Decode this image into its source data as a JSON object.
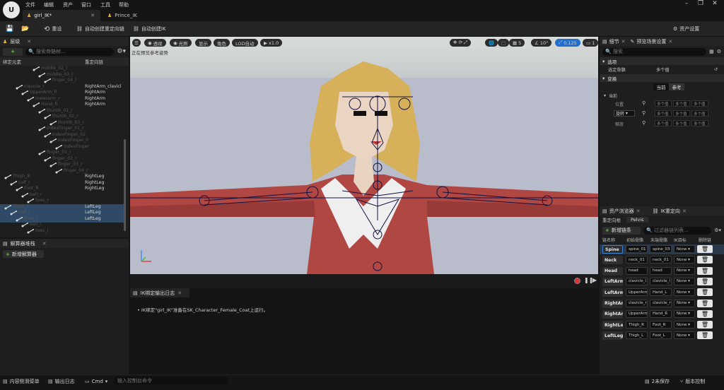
{
  "menu": [
    "文件",
    "编辑",
    "资产",
    "窗口",
    "工具",
    "帮助"
  ],
  "tabs": [
    {
      "label": "girl_IK*"
    },
    {
      "label": "Prince_IK"
    }
  ],
  "toolbar": {
    "reimport": "重设",
    "auto_chain": "自动创建重定向链",
    "auto_ik": "自动创建IK",
    "asset_settings": "资产设置"
  },
  "hierarchy": {
    "title": "层级",
    "add": "+",
    "search_placeholder": "搜索骨骼树...",
    "col_bone": "绑定元素",
    "col_retarget": "重定向链",
    "rows": [
      {
        "name": "middle_02_l",
        "chain": "",
        "indent": 58,
        "selected": false
      },
      {
        "name": "middle_03_l",
        "chain": "",
        "indent": 66,
        "selected": false
      },
      {
        "name": "finger_04_l",
        "chain": "",
        "indent": 74,
        "selected": false
      },
      {
        "name": "clavicle_r",
        "chain": "RightArm_clavicl",
        "indent": 34,
        "selected": false
      },
      {
        "name": "UpperArm_R",
        "chain": "RightArm",
        "indent": 42,
        "selected": false
      },
      {
        "name": "lowerarm_r",
        "chain": "RightArm",
        "indent": 50,
        "selected": false
      },
      {
        "name": "Hand_R",
        "chain": "RightArm",
        "indent": 58,
        "selected": false
      },
      {
        "name": "thumb_01_r",
        "chain": "",
        "indent": 66,
        "selected": false
      },
      {
        "name": "thumb_02_r",
        "chain": "",
        "indent": 74,
        "selected": false
      },
      {
        "name": "thumb_03_r",
        "chain": "",
        "indent": 82,
        "selected": false
      },
      {
        "name": "IndexFinger_01_r",
        "chain": "",
        "indent": 66,
        "selected": false
      },
      {
        "name": "IndexFinger_02",
        "chain": "",
        "indent": 74,
        "selected": false
      },
      {
        "name": "IndexFinger_0",
        "chain": "",
        "indent": 82,
        "selected": false
      },
      {
        "name": "IndexFinger",
        "chain": "",
        "indent": 90,
        "selected": false
      },
      {
        "name": "finger_01_r",
        "chain": "",
        "indent": 66,
        "selected": false
      },
      {
        "name": "finger_02_r",
        "chain": "",
        "indent": 74,
        "selected": false
      },
      {
        "name": "finger_03_r",
        "chain": "",
        "indent": 82,
        "selected": false
      },
      {
        "name": "finger_04_r",
        "chain": "",
        "indent": 90,
        "selected": false
      },
      {
        "name": "Thigh_R",
        "chain": "RightLeg",
        "indent": 18,
        "selected": false
      },
      {
        "name": "calf_r",
        "chain": "RightLeg",
        "indent": 26,
        "selected": false
      },
      {
        "name": "Foot_R",
        "chain": "RightLeg",
        "indent": 34,
        "selected": false
      },
      {
        "name": "ball_r",
        "chain": "",
        "indent": 42,
        "selected": false
      },
      {
        "name": "toes_r",
        "chain": "",
        "indent": 50,
        "selected": false
      },
      {
        "name": "Thigh_L",
        "chain": "LeftLeg",
        "indent": 18,
        "selected": true
      },
      {
        "name": "calf_l",
        "chain": "LeftLeg",
        "indent": 26,
        "selected": true
      },
      {
        "name": "Foot_L",
        "chain": "LeftLeg",
        "indent": 34,
        "selected": true
      },
      {
        "name": "ball_l",
        "chain": "",
        "indent": 42,
        "selected": false
      },
      {
        "name": "toes_l",
        "chain": "",
        "indent": 50,
        "selected": false
      }
    ]
  },
  "solver": {
    "title": "解算器堆栈",
    "add": "新增解算器"
  },
  "viewport": {
    "perspective": "透视",
    "lit": "光照",
    "show": "显示",
    "character": "角色",
    "lod": "LOD自动",
    "play": "x1.0",
    "hint": "正在预览参考姿势",
    "grid_snap": "10",
    "angle_snap": "10°",
    "scale_snap": "0.125",
    "cam_speed": "1",
    "screen_pct": "5"
  },
  "output": {
    "title": "IK绑定输出日志",
    "message": "IK绑定\"girl_IK\"准备在SK_Character_Female_Coat上运行。"
  },
  "details": {
    "title": "细节",
    "preview_title": "预览场景设置",
    "search_placeholder": "搜索",
    "sec_selection": "选项",
    "selected_bone_label": "选定骨骼",
    "selected_bone_value": "多个值",
    "sec_transform": "变换",
    "btn_current": "当前",
    "btn_reference": "参考",
    "current": "当前",
    "location": "位置",
    "rotation": "旋转",
    "scale": "缩放",
    "multi": "多个值"
  },
  "retarget": {
    "asset_tab": "资产浏览器",
    "ik_tab": "IK重定向",
    "root_label": "重定向根",
    "root_value": "Pelvis",
    "add_chain": "新增链条",
    "filter_placeholder": "过滤器链列表...",
    "headers": [
      "链名称",
      "初始骨骼",
      "末端骨骼",
      "IK目标",
      "删除链"
    ],
    "chains": [
      {
        "name": "Spine",
        "start": "spine_01",
        "end": "spine_03",
        "goal": "None",
        "selected": true
      },
      {
        "name": "Neck",
        "start": "neck_01",
        "end": "neck_01",
        "goal": "None",
        "selected": false
      },
      {
        "name": "Head",
        "start": "head",
        "end": "head",
        "goal": "None",
        "selected": false
      },
      {
        "name": "LeftArm_",
        "start": "clavicle_l",
        "end": "clavicle_l",
        "goal": "None",
        "selected": false
      },
      {
        "name": "LeftArm",
        "start": "UpperArm",
        "end": "Hand_L",
        "goal": "None",
        "selected": false
      },
      {
        "name": "RightArm",
        "start": "clavicle_r",
        "end": "clavicle_r",
        "goal": "None",
        "selected": false
      },
      {
        "name": "RightArm",
        "start": "UpperArm",
        "end": "Hand_R",
        "goal": "None",
        "selected": false
      },
      {
        "name": "RightLeg",
        "start": "Thigh_R",
        "end": "Foot_R",
        "goal": "None",
        "selected": false
      },
      {
        "name": "LeftLeg",
        "start": "Thigh_L",
        "end": "Foot_L",
        "goal": "None",
        "selected": false
      }
    ]
  },
  "statusbar": {
    "content_drawer": "内容侧滑菜单",
    "output_log": "输出日志",
    "cmd": "Cmd",
    "cmd_placeholder": "输入控制台命令",
    "unsaved": "2未保存",
    "source_control": "版本控制"
  }
}
